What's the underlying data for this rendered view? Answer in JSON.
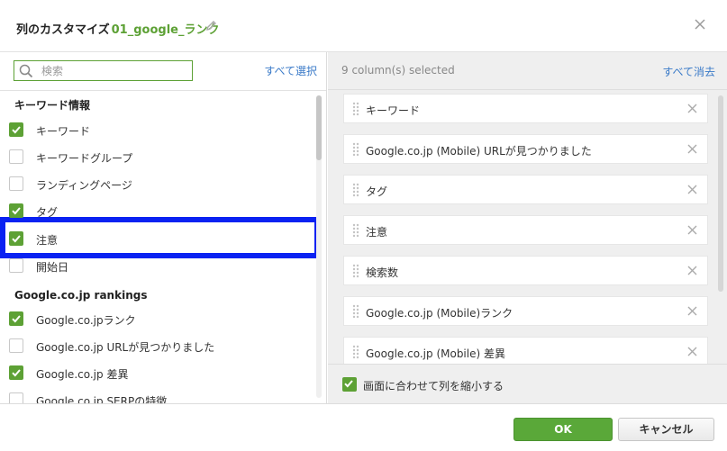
{
  "header": {
    "title_prefix": "列のカスタマイズ",
    "report_name": "01_google_ランク"
  },
  "left": {
    "search_placeholder": "検索",
    "select_all_label": "すべて選択",
    "sections": [
      {
        "title": "キーワード情報",
        "items": [
          {
            "label": "キーワード",
            "checked": true
          },
          {
            "label": "キーワードグループ",
            "checked": false
          },
          {
            "label": "ランディングページ",
            "checked": false
          },
          {
            "label": "タグ",
            "checked": true
          },
          {
            "label": "注意",
            "checked": true,
            "highlighted": true
          },
          {
            "label": "開始日",
            "checked": false
          }
        ]
      },
      {
        "title": "Google.co.jp rankings",
        "items": [
          {
            "label": "Google.co.jpランク",
            "checked": true
          },
          {
            "label": "Google.co.jp URLが見つかりました",
            "checked": false
          },
          {
            "label": "Google.co.jp 差異",
            "checked": true
          },
          {
            "label": "Google.co.jp SERPの特徴",
            "checked": false
          }
        ]
      }
    ]
  },
  "right": {
    "count_label": "9 column(s) selected",
    "clear_all_label": "すべて消去",
    "selected": [
      "キーワード",
      "Google.co.jp (Mobile) URLが見つかりました",
      "タグ",
      "注意",
      "検索数",
      "Google.co.jp (Mobile)ランク",
      "Google.co.jp (Mobile) 差異"
    ],
    "fit_label": "画面に合わせて列を縮小する",
    "fit_checked": true
  },
  "footer": {
    "ok_label": "OK",
    "cancel_label": "キャンセル"
  },
  "colors": {
    "accent_green": "#5da135",
    "link_blue": "#3a7ac8",
    "highlight_blue": "#0a22f2"
  }
}
